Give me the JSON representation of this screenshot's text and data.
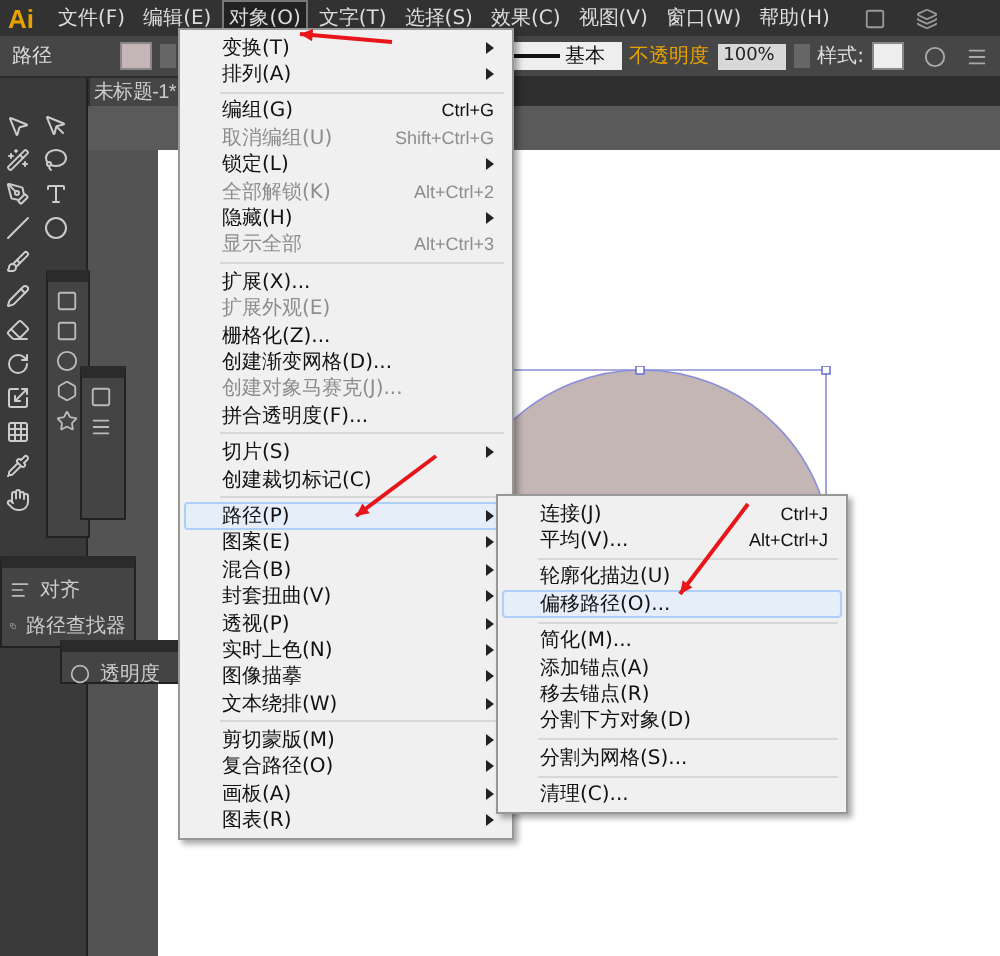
{
  "app": {
    "logo": "Ai"
  },
  "menu_bar": [
    {
      "label": "文件(F)",
      "selected": false
    },
    {
      "label": "编辑(E)",
      "selected": false
    },
    {
      "label": "对象(O)",
      "selected": true
    },
    {
      "label": "文字(T)",
      "selected": false
    },
    {
      "label": "选择(S)",
      "selected": false
    },
    {
      "label": "效果(C)",
      "selected": false
    },
    {
      "label": "视图(V)",
      "selected": false
    },
    {
      "label": "窗口(W)",
      "selected": false
    },
    {
      "label": "帮助(H)",
      "selected": false
    }
  ],
  "control_bar": {
    "selection": "路径",
    "stroke_style": "基本",
    "opacity_label": "不透明度",
    "opacity": "100%",
    "style_label": "样式:"
  },
  "document_tab": {
    "title": "未标题-1*"
  },
  "panels": [
    {
      "label": "对齐"
    },
    {
      "label": "路径查找器"
    }
  ],
  "transparency_panel": {
    "label": "透明度"
  },
  "object_menu": [
    {
      "kind": "item",
      "label": "变换(T)",
      "submenu": true,
      "disabled": false,
      "selected": false
    },
    {
      "kind": "item",
      "label": "排列(A)",
      "submenu": true,
      "disabled": false,
      "selected": false
    },
    {
      "kind": "separator"
    },
    {
      "kind": "item",
      "label": "编组(G)",
      "shortcut": "Ctrl+G",
      "submenu": false,
      "disabled": false,
      "selected": false
    },
    {
      "kind": "item",
      "label": "取消编组(U)",
      "shortcut": "Shift+Ctrl+G",
      "submenu": false,
      "disabled": true,
      "selected": false
    },
    {
      "kind": "item",
      "label": "锁定(L)",
      "submenu": true,
      "disabled": false,
      "selected": false
    },
    {
      "kind": "item",
      "label": "全部解锁(K)",
      "shortcut": "Alt+Ctrl+2",
      "submenu": false,
      "disabled": true,
      "selected": false
    },
    {
      "kind": "item",
      "label": "隐藏(H)",
      "submenu": true,
      "disabled": false,
      "selected": false
    },
    {
      "kind": "item",
      "label": "显示全部",
      "shortcut": "Alt+Ctrl+3",
      "submenu": false,
      "disabled": true,
      "selected": false
    },
    {
      "kind": "separator"
    },
    {
      "kind": "item",
      "label": "扩展(X)...",
      "submenu": false,
      "disabled": false,
      "selected": false
    },
    {
      "kind": "item",
      "label": "扩展外观(E)",
      "submenu": false,
      "disabled": true,
      "selected": false
    },
    {
      "kind": "item",
      "label": "栅格化(Z)...",
      "submenu": false,
      "disabled": false,
      "selected": false
    },
    {
      "kind": "item",
      "label": "创建渐变网格(D)...",
      "submenu": false,
      "disabled": false,
      "selected": false
    },
    {
      "kind": "item",
      "label": "创建对象马赛克(J)...",
      "submenu": false,
      "disabled": true,
      "selected": false
    },
    {
      "kind": "item",
      "label": "拼合透明度(F)...",
      "submenu": false,
      "disabled": false,
      "selected": false
    },
    {
      "kind": "separator"
    },
    {
      "kind": "item",
      "label": "切片(S)",
      "submenu": true,
      "disabled": false,
      "selected": false
    },
    {
      "kind": "item",
      "label": "创建裁切标记(C)",
      "submenu": false,
      "disabled": false,
      "selected": false
    },
    {
      "kind": "separator"
    },
    {
      "kind": "item",
      "label": "路径(P)",
      "submenu": true,
      "disabled": false,
      "selected": true
    },
    {
      "kind": "item",
      "label": "图案(E)",
      "submenu": true,
      "disabled": false,
      "selected": false
    },
    {
      "kind": "item",
      "label": "混合(B)",
      "submenu": true,
      "disabled": false,
      "selected": false
    },
    {
      "kind": "item",
      "label": "封套扭曲(V)",
      "submenu": true,
      "disabled": false,
      "selected": false
    },
    {
      "kind": "item",
      "label": "透视(P)",
      "submenu": true,
      "disabled": false,
      "selected": false
    },
    {
      "kind": "item",
      "label": "实时上色(N)",
      "submenu": true,
      "disabled": false,
      "selected": false
    },
    {
      "kind": "item",
      "label": "图像描摹",
      "submenu": true,
      "disabled": false,
      "selected": false
    },
    {
      "kind": "item",
      "label": "文本绕排(W)",
      "submenu": true,
      "disabled": false,
      "selected": false
    },
    {
      "kind": "separator"
    },
    {
      "kind": "item",
      "label": "剪切蒙版(M)",
      "submenu": true,
      "disabled": false,
      "selected": false
    },
    {
      "kind": "item",
      "label": "复合路径(O)",
      "submenu": true,
      "disabled": false,
      "selected": false
    },
    {
      "kind": "item",
      "label": "画板(A)",
      "submenu": true,
      "disabled": false,
      "selected": false
    },
    {
      "kind": "item",
      "label": "图表(R)",
      "submenu": true,
      "disabled": false,
      "selected": false
    }
  ],
  "path_submenu": [
    {
      "kind": "item",
      "label": "连接(J)",
      "shortcut": "Ctrl+J",
      "submenu": false,
      "disabled": false,
      "selected": false
    },
    {
      "kind": "item",
      "label": "平均(V)...",
      "shortcut": "Alt+Ctrl+J",
      "submenu": false,
      "disabled": false,
      "selected": false
    },
    {
      "kind": "separator"
    },
    {
      "kind": "item",
      "label": "轮廓化描边(U)",
      "submenu": false,
      "disabled": false,
      "selected": false
    },
    {
      "kind": "item",
      "label": "偏移路径(O)...",
      "submenu": false,
      "disabled": false,
      "selected": true
    },
    {
      "kind": "separator"
    },
    {
      "kind": "item",
      "label": "简化(M)...",
      "submenu": false,
      "disabled": false,
      "selected": false
    },
    {
      "kind": "item",
      "label": "添加锚点(A)",
      "submenu": false,
      "disabled": false,
      "selected": false
    },
    {
      "kind": "item",
      "label": "移去锚点(R)",
      "submenu": false,
      "disabled": false,
      "selected": false
    },
    {
      "kind": "item",
      "label": "分割下方对象(D)",
      "submenu": false,
      "disabled": false,
      "selected": false
    },
    {
      "kind": "separator"
    },
    {
      "kind": "item",
      "label": "分割为网格(S)...",
      "submenu": false,
      "disabled": false,
      "selected": false
    },
    {
      "kind": "separator"
    },
    {
      "kind": "item",
      "label": "清理(C)...",
      "submenu": false,
      "disabled": false,
      "selected": false
    }
  ]
}
